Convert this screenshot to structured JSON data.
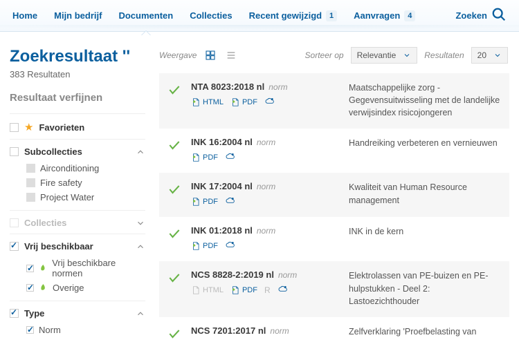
{
  "nav": {
    "items": [
      {
        "label": "Home"
      },
      {
        "label": "Mijn bedrijf"
      },
      {
        "label": "Documenten",
        "active": true
      },
      {
        "label": "Collecties"
      },
      {
        "label": "Recent gewijzigd",
        "badge": "1"
      },
      {
        "label": "Aanvragen",
        "badge": "4"
      }
    ],
    "search_label": "Zoeken"
  },
  "page": {
    "title": "Zoekresultaat ''",
    "count": "383 Resultaten",
    "refine": "Resultaat verfijnen"
  },
  "facets": {
    "fav": {
      "label": "Favorieten"
    },
    "sub": {
      "label": "Subcollecties",
      "items": [
        "Airconditioning",
        "Fire safety",
        "Project Water"
      ]
    },
    "col": {
      "label": "Collecties"
    },
    "vrij": {
      "label": "Vrij beschikbaar",
      "items": [
        "Vrij beschikbare normen",
        "Overige"
      ]
    },
    "type": {
      "label": "Type",
      "items": [
        "Norm"
      ]
    }
  },
  "controls": {
    "view_label": "Weergave",
    "sort_label": "Sorteer op",
    "sort_value": "Relevantie",
    "perpage_label": "Resultaten",
    "perpage_value": "20"
  },
  "results": [
    {
      "id": "NTA 8023:2018 nl",
      "type": "norm",
      "desc": "Maatschappelijke zorg - Gegevensuitwisseling met de landelijke verwijsindex risicojongeren",
      "fmts": [
        {
          "t": "HTML",
          "leaf": true
        },
        {
          "t": "PDF",
          "leaf": true
        }
      ],
      "cloud": true,
      "alt": true
    },
    {
      "id": "INK 16:2004 nl",
      "type": "norm",
      "desc": "Handreiking verbeteren en vernieuwen",
      "fmts": [
        {
          "t": "PDF",
          "leaf": true
        }
      ],
      "cloud": true,
      "alt": false
    },
    {
      "id": "INK 17:2004 nl",
      "type": "norm",
      "desc": "Kwaliteit van Human Resource management",
      "fmts": [
        {
          "t": "PDF",
          "leaf": true
        }
      ],
      "cloud": true,
      "alt": true
    },
    {
      "id": "INK 01:2018 nl",
      "type": "norm",
      "desc": "INK in de kern",
      "fmts": [
        {
          "t": "PDF",
          "leaf": true
        }
      ],
      "cloud": true,
      "alt": false
    },
    {
      "id": "NCS 8828-2:2019 nl",
      "type": "norm",
      "desc": "Elektrolassen van PE-buizen en PE-hulpstukken - Deel 2: Lastoezichthouder",
      "fmts": [
        {
          "t": "HTML",
          "muted": true
        },
        {
          "t": "PDF",
          "leaf": true
        }
      ],
      "revoked": "R",
      "cloud": true,
      "alt": true
    },
    {
      "id": "NCS 7201:2017 nl",
      "type": "norm",
      "desc": "Zelfverklaring 'Proefbelasting van",
      "fmts": [],
      "alt": false,
      "partial": true
    }
  ]
}
